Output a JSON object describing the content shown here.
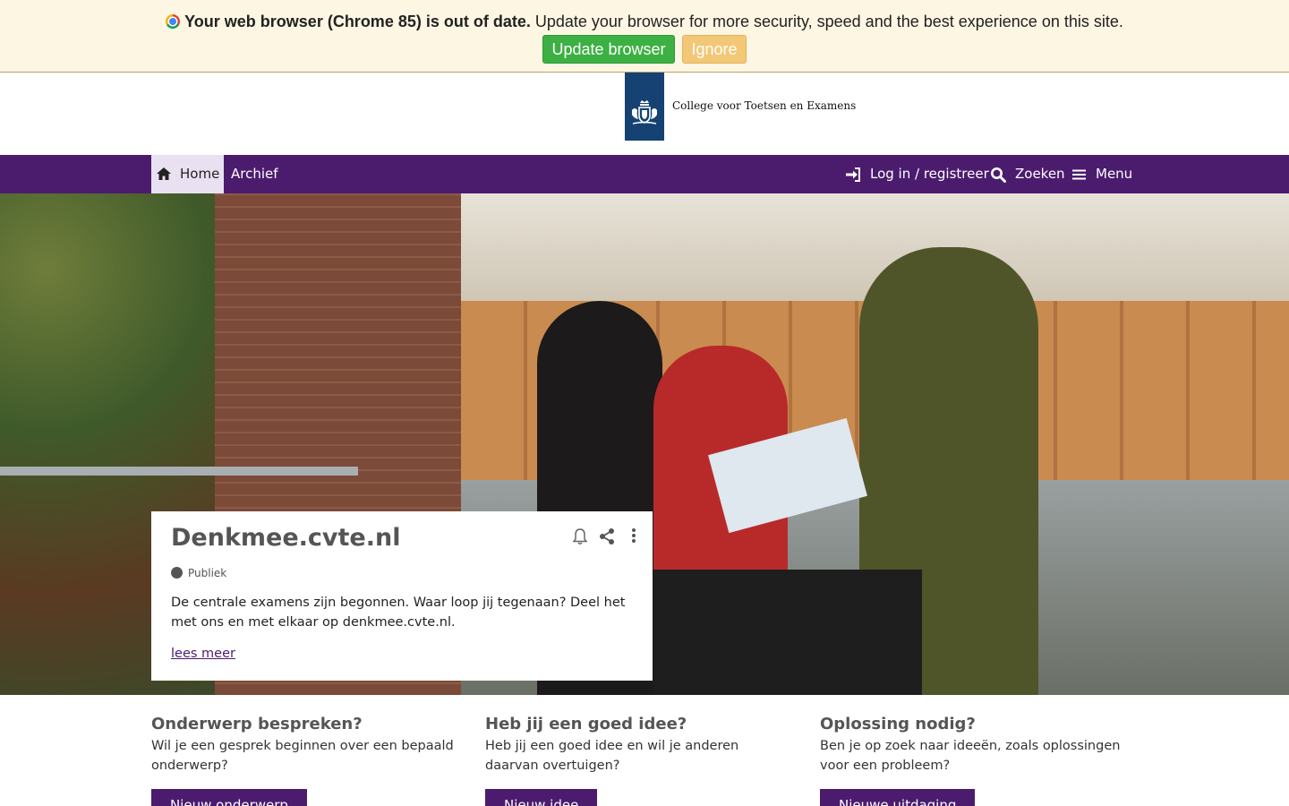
{
  "update_banner": {
    "bold_text": "Your web browser (Chrome 85) is out of date.",
    "rest_text": "Update your browser for more security, speed and the best experience on this site.",
    "update_button": "Update browser",
    "ignore_button": "Ignore",
    "colors": {
      "background": "#fdf6e3",
      "update": "#3cb043",
      "ignore": "#f2c775"
    }
  },
  "header": {
    "org_name": "College voor Toetsen en Examens",
    "logo_color": "#154273"
  },
  "nav": {
    "home": "Home",
    "archief": "Archief",
    "login": "Log in / registreer",
    "search": "Zoeken",
    "menu": "Menu",
    "background": "#4b1c6e"
  },
  "card": {
    "title": "Denkmee.cvte.nl",
    "visibility": "Publiek",
    "description": "De centrale examens zijn begonnen. Waar loop jij tegenaan? Deel het met ons en met elkaar op denkmee.cvte.nl.",
    "read_more": "lees meer",
    "icons": [
      "bell-icon",
      "share-icon",
      "more-vertical-icon"
    ]
  },
  "columns": [
    {
      "title": "Onderwerp bespreken?",
      "text": "Wil je een gesprek beginnen over een bepaald onderwerp?",
      "button": "Nieuw onderwerp"
    },
    {
      "title": "Heb jij een goed idee?",
      "text": "Heb jij een goed idee en wil je anderen daarvan overtuigen?",
      "button": "Nieuw idee"
    },
    {
      "title": "Oplossing nodig?",
      "text": "Ben je op zoek naar ideeën, zoals oplossingen voor een probleem?",
      "button": "Nieuwe uitdaging"
    }
  ]
}
